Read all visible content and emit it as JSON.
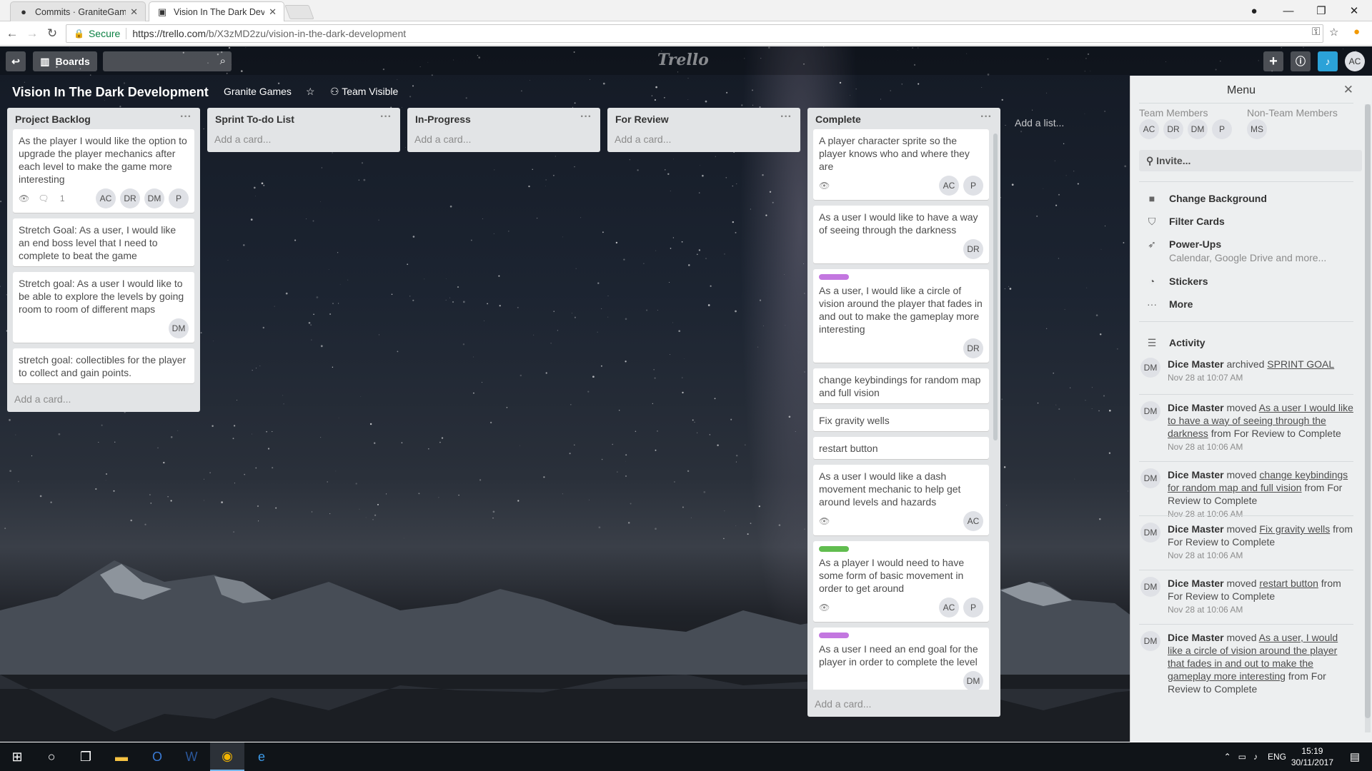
{
  "browser": {
    "tabs": [
      {
        "label": "Commits · GraniteGames",
        "icon": "github-icon"
      },
      {
        "label": "Vision In The Dark Devel",
        "icon": "trello-icon"
      }
    ],
    "secure_label": "Secure",
    "url_host": "https://trello.com",
    "url_path": "/b/X3zMD2zu/vision-in-the-dark-development"
  },
  "header": {
    "boards_label": "Boards",
    "logo": "Trello",
    "user_initials": "AC"
  },
  "board": {
    "title": "Vision In The Dark Development",
    "team": "Granite Games",
    "visibility": "Team Visible",
    "add_list": "Add a list..."
  },
  "lists": [
    {
      "name": "Project Backlog",
      "cards": [
        {
          "text": "As the player I would like the option to upgrade the player mechanics after each level to make the game more interesting",
          "watch": true,
          "comments": "1",
          "members": [
            "AC",
            "DR",
            "DM",
            "P"
          ]
        },
        {
          "text": "Stretch Goal: As a user, I would like an end boss level that I need to complete to beat the game",
          "members": []
        },
        {
          "text": "Stretch goal: As a user I would like to be able to explore the levels by going room to room of different maps",
          "members": [
            "DM"
          ]
        },
        {
          "text": "stretch goal: collectibles for the player to collect and gain points.",
          "members": []
        }
      ],
      "add_card": "Add a card..."
    },
    {
      "name": "Sprint To-do List",
      "cards": [],
      "add_card": "Add a card..."
    },
    {
      "name": "In-Progress",
      "cards": [],
      "add_card": "Add a card..."
    },
    {
      "name": "For Review",
      "cards": [],
      "add_card": "Add a card..."
    },
    {
      "name": "Complete",
      "cards": [
        {
          "text": "A player character sprite so the player knows who and where they are",
          "watch": true,
          "members": [
            "AC",
            "P"
          ]
        },
        {
          "text": "As a user I would like to have a way of seeing through the darkness",
          "members": [
            "DR"
          ]
        },
        {
          "label_color": "#c377e0",
          "text": "As a user, I would like a circle of vision around the player that fades in and out to make the gameplay more interesting",
          "members": [
            "DR"
          ]
        },
        {
          "text": "change keybindings for random map and full vision",
          "members": []
        },
        {
          "text": "Fix gravity wells",
          "members": []
        },
        {
          "text": "restart button",
          "members": []
        },
        {
          "text": "As a user I would like a dash movement mechanic to help get around levels and hazards",
          "watch": true,
          "members": [
            "AC"
          ]
        },
        {
          "label_color": "#61bd4f",
          "text": "As a player I would need to have some form of basic movement in order to get around",
          "watch": true,
          "members": [
            "AC",
            "P"
          ]
        },
        {
          "label_color": "#c377e0",
          "text": "As a user I need an end goal for the player in order to complete the level",
          "members": [
            "DM"
          ]
        }
      ],
      "add_card": "Add a card..."
    }
  ],
  "menu": {
    "title": "Menu",
    "team_members_label": "Team Members",
    "non_team_members_label": "Non-Team Members",
    "team_members": [
      "AC",
      "DR",
      "DM",
      "P"
    ],
    "non_team_members": [
      "MS"
    ],
    "invite": "Invite...",
    "items": {
      "change_background": "Change Background",
      "filter_cards": "Filter Cards",
      "power_ups": "Power-Ups",
      "power_ups_sub": "Calendar, Google Drive and more...",
      "stickers": "Stickers",
      "more": "More"
    },
    "activity_label": "Activity",
    "activity": [
      {
        "user": "Dice Master",
        "verb": "archived",
        "link": "SPRINT GOAL",
        "rest": "",
        "time": "Nov 28 at 10:07 AM"
      },
      {
        "user": "Dice Master",
        "verb": "moved",
        "link": "As a user I would like to have a way of seeing through the darkness",
        "rest": "from For Review to Complete",
        "time": "Nov 28 at 10:06 AM"
      },
      {
        "user": "Dice Master",
        "verb": "moved",
        "link": "change keybindings for random map and full vision",
        "rest": "from For Review to Complete",
        "time": "Nov 28 at 10:06 AM"
      },
      {
        "user": "Dice Master",
        "verb": "moved",
        "link": "Fix gravity wells",
        "rest": "from For Review to Complete",
        "time": "Nov 28 at 10:06 AM"
      },
      {
        "user": "Dice Master",
        "verb": "moved",
        "link": "restart button",
        "rest": "from For Review to Complete",
        "time": "Nov 28 at 10:06 AM"
      },
      {
        "user": "Dice Master",
        "verb": "moved",
        "link": "As a user, I would like a circle of vision around the player that fades in and out to make the gameplay more interesting",
        "rest": "from For Review to Complete",
        "time": ""
      }
    ],
    "activity_initials": "DM"
  },
  "taskbar": {
    "lang": "ENG",
    "time": "15:19",
    "date": "30/11/2017"
  }
}
